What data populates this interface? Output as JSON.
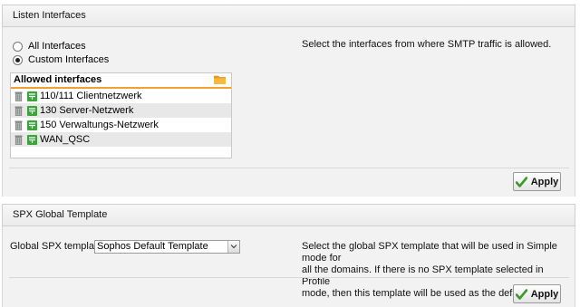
{
  "listen_interfaces": {
    "title": "Listen Interfaces",
    "radio_all": "All Interfaces",
    "radio_custom": "Custom Interfaces",
    "selected": "custom",
    "list_header": "Allowed interfaces",
    "items": [
      "110/111 Clientnetzwerk",
      "130 Server-Netzwerk",
      "150 Verwaltungs-Netzwerk",
      "WAN_QSC"
    ],
    "description": "Select the interfaces from where SMTP traffic is allowed.",
    "apply_label": "Apply"
  },
  "spx_template": {
    "title": "SPX Global Template",
    "field_label": "Global SPX template:",
    "selected_value": "Sophos Default Template",
    "description_lines": [
      "Select the global SPX template that will be used in Simple mode for",
      "all the domains. If there is no SPX template selected in Profile",
      "mode, then this template will be used as the default."
    ],
    "apply_label": "Apply"
  },
  "colors": {
    "accent_orange": "#f2a030",
    "net_icon_green": "#3aa33a",
    "check_green": "#3a9a2a"
  }
}
